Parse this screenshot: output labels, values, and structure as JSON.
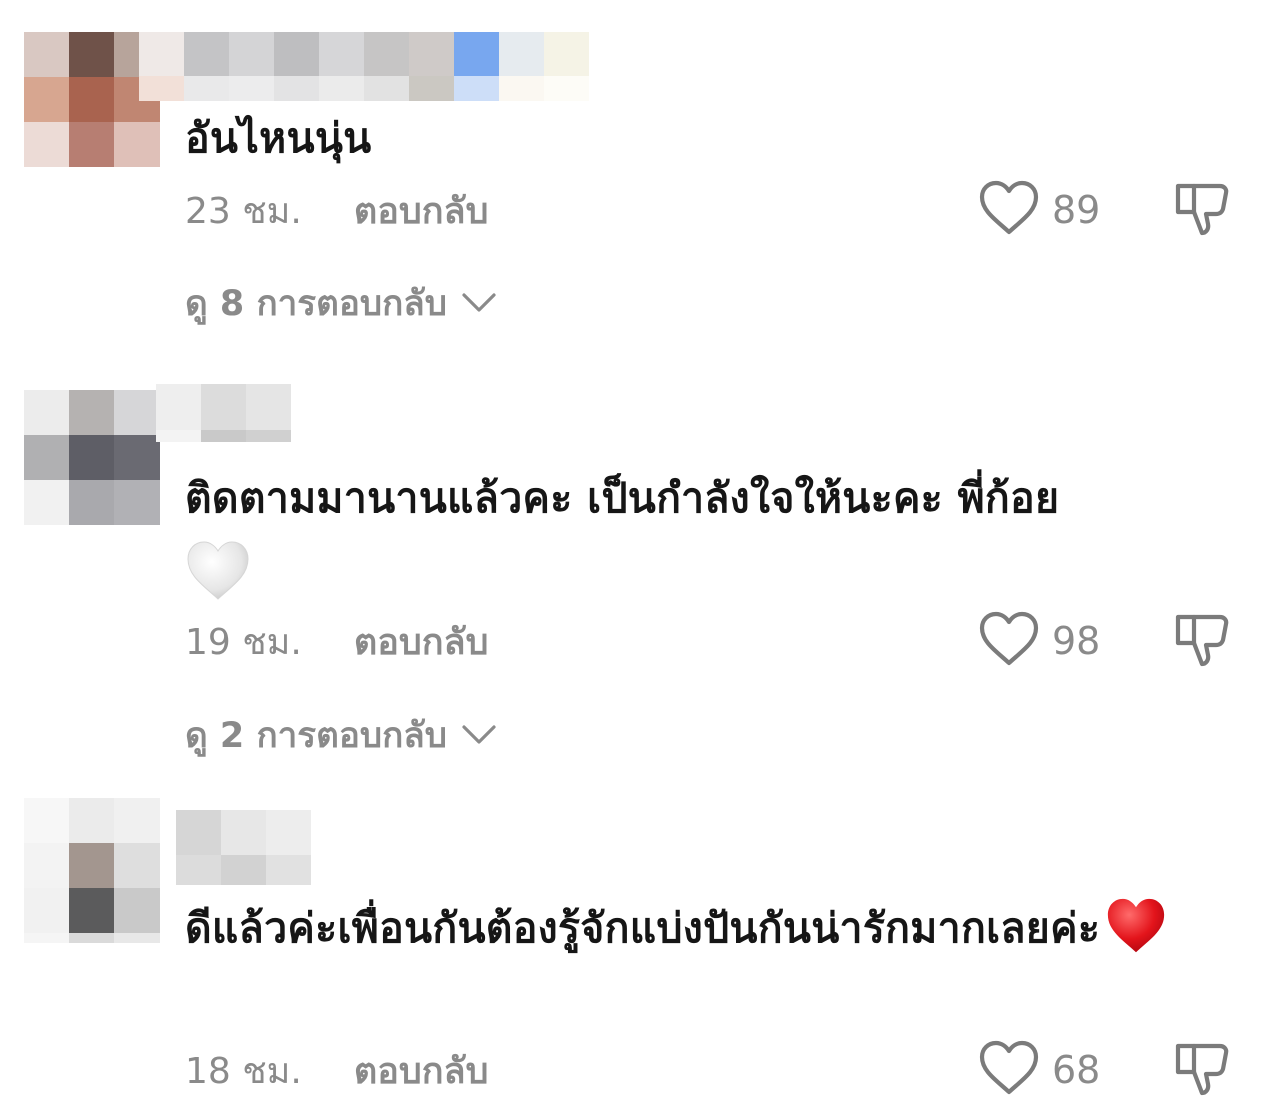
{
  "comments": [
    {
      "text": "อันไหนนุ่น",
      "emoji": "",
      "timestamp": "23 ชม.",
      "reply_label": "ตอบกลับ",
      "likes": "89",
      "view_replies": "ดู 8 การตอบกลับ"
    },
    {
      "text": "ติดตามมานานแล้วคะ เป็นกำลังใจให้นะคะ พี่ก้อย",
      "emoji": "🤍",
      "timestamp": "19 ชม.",
      "reply_label": "ตอบกลับ",
      "likes": "98",
      "view_replies": "ดู 2 การตอบกลับ"
    },
    {
      "text": "ดีแล้วค่ะเพื่อนกันต้องรู้จักแบ่งปันกันน่ารักมากเลยค่ะ",
      "emoji": "❤️",
      "timestamp": "18 ชม.",
      "reply_label": "ตอบกลับ",
      "likes": "68",
      "view_replies": ""
    }
  ],
  "icons": {
    "like": "heart-outline-icon",
    "dislike": "thumbs-down-outline-icon",
    "expand": "chevron-down-icon"
  },
  "colors": {
    "text": "#161616",
    "muted": "#8a8a8a",
    "background": "#ffffff"
  }
}
